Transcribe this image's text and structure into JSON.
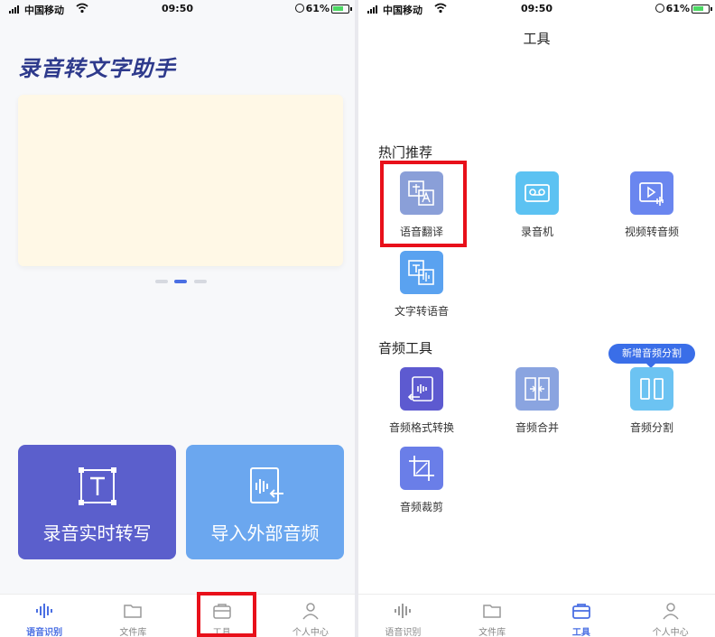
{
  "status_bar": {
    "carrier": "中国移动",
    "time": "09:50",
    "battery": "61%"
  },
  "home": {
    "app_title": "录音转文字助手",
    "cards": {
      "record_label": "录音实时转写",
      "import_label": "导入外部音频"
    }
  },
  "tools_page": {
    "title": "工具",
    "hot_section": "热门推荐",
    "hot_items": [
      {
        "label": "语音翻译",
        "icon": "translate-icon",
        "color": "#8a9fd8"
      },
      {
        "label": "录音机",
        "icon": "recorder-icon",
        "color": "#5cc2f2"
      },
      {
        "label": "视频转音频",
        "icon": "video-to-audio-icon",
        "color": "#6a86ef"
      },
      {
        "label": "文字转语音",
        "icon": "text-to-speech-icon",
        "color": "#5aa2f0"
      }
    ],
    "audio_section": "音频工具",
    "audio_badge": "新增音频分割",
    "audio_items": [
      {
        "label": "音频格式转换",
        "icon": "format-convert-icon",
        "color": "#5d5ad0"
      },
      {
        "label": "音频合并",
        "icon": "merge-icon",
        "color": "#8aa4e0"
      },
      {
        "label": "音频分割",
        "icon": "split-icon",
        "color": "#6cc3f2"
      },
      {
        "label": "音频裁剪",
        "icon": "crop-icon",
        "color": "#6a7ee8"
      }
    ]
  },
  "tabbar": {
    "tabs": [
      "语音识别",
      "文件库",
      "工具",
      "个人中心"
    ]
  },
  "colors": {
    "accent": "#4a6fe3",
    "highlight": "#e8101a"
  }
}
